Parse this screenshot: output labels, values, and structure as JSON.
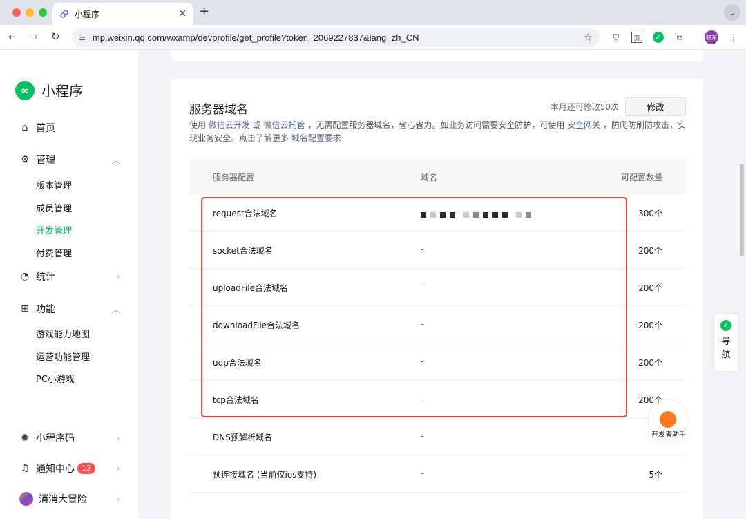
{
  "browser": {
    "tab_title": "小程序",
    "url": "mp.weixin.qq.com/wxamp/devprofile/get_profile?token=2069227837&lang=zh_CN",
    "profile_label": "晓东",
    "traffic_colors": [
      "#ff5f57",
      "#febc2e",
      "#28c840"
    ]
  },
  "sidebar": {
    "app_name": "小程序",
    "home": "首页",
    "manage": "管理",
    "manage_items": [
      "版本管理",
      "成员管理",
      "开发管理",
      "付费管理"
    ],
    "active_item": "开发管理",
    "stats": "统计",
    "features": "功能",
    "feature_items": [
      "游戏能力地图",
      "运营功能管理",
      "PC小游戏"
    ],
    "qrcode": "小程序码",
    "notify": "通知中心",
    "notify_count": "12",
    "account": "消消大冒险"
  },
  "main": {
    "section_title": "服务器域名",
    "quota_text": "本月还可修改50次",
    "edit_label": "修改",
    "desc_1": "使用 ",
    "link_1": "微信云开发",
    "desc_2": " 或 ",
    "link_2": "微信云托管",
    "desc_3": " ，无需配置服务器域名，省心省力。如业务访问需要安全防护，可使用 ",
    "link_3": "安全网关",
    "desc_4": " ，防爬防刷防攻击，实现业务安全。点击了解更多 ",
    "link_4": "域名配置要求",
    "columns": [
      "服务器配置",
      "域名",
      "可配置数量"
    ],
    "rows": [
      {
        "name": "request合法域名",
        "domain": "",
        "count": "300个"
      },
      {
        "name": "socket合法域名",
        "domain": "-",
        "count": "200个"
      },
      {
        "name": "uploadFile合法域名",
        "domain": "-",
        "count": "200个"
      },
      {
        "name": "downloadFile合法域名",
        "domain": "-",
        "count": "200个"
      },
      {
        "name": "udp合法域名",
        "domain": "-",
        "count": "200个"
      },
      {
        "name": "tcp合法域名",
        "domain": "-",
        "count": "200个"
      },
      {
        "name": "DNS预解析域名",
        "domain": "-",
        "count": ""
      },
      {
        "name": "预连接域名 (当前仅ios支持)",
        "domain": "-",
        "count": "5个"
      }
    ]
  },
  "floating": {
    "guide_label_1": "导",
    "guide_label_2": "航",
    "dev_helper": "开发者助手"
  }
}
